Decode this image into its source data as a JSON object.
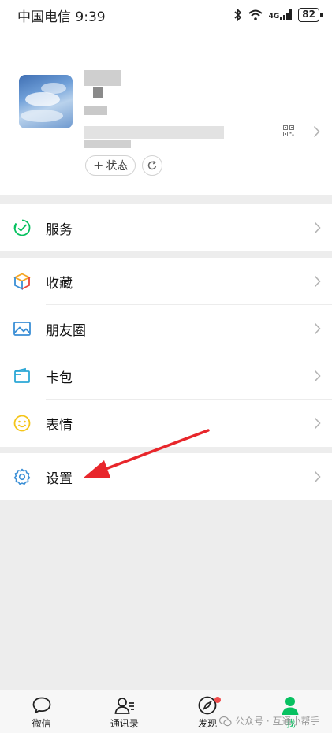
{
  "status_bar": {
    "carrier_time": "中国电信 9:39",
    "network": "4G",
    "battery": "82",
    "icons": [
      "bluetooth-icon",
      "wifi-icon",
      "signal-icon",
      "battery-icon"
    ]
  },
  "profile": {
    "status_label": "状态",
    "icons": [
      "avatar",
      "qr-code-icon",
      "chevron-right-icon",
      "refresh-icon"
    ]
  },
  "menu": {
    "group1": [
      {
        "label": "服务",
        "icon": "service-icon",
        "color": "#07c160"
      }
    ],
    "group2": [
      {
        "label": "收藏",
        "icon": "favorites-cube-icon",
        "color": "#f5a623"
      },
      {
        "label": "朋友圈",
        "icon": "moments-image-icon",
        "color": "#3b8fd6"
      },
      {
        "label": "卡包",
        "icon": "card-wallet-icon",
        "color": "#2ba7d6"
      },
      {
        "label": "表情",
        "icon": "sticker-smiley-icon",
        "color": "#f5c518"
      }
    ],
    "group3": [
      {
        "label": "设置",
        "icon": "settings-gear-icon",
        "color": "#3b8fd6"
      }
    ]
  },
  "tabbar": {
    "tabs": [
      {
        "label": "微信",
        "icon": "chat-bubble-icon"
      },
      {
        "label": "通讯录",
        "icon": "contacts-icon"
      },
      {
        "label": "发现",
        "icon": "compass-icon"
      },
      {
        "label": "我",
        "icon": "me-person-icon",
        "active": true
      }
    ]
  },
  "watermark": "公众号 · 互通小帮手",
  "colors": {
    "accent": "#07c160",
    "badge": "#f04b4b",
    "annotation_arrow": "#e8262b"
  }
}
